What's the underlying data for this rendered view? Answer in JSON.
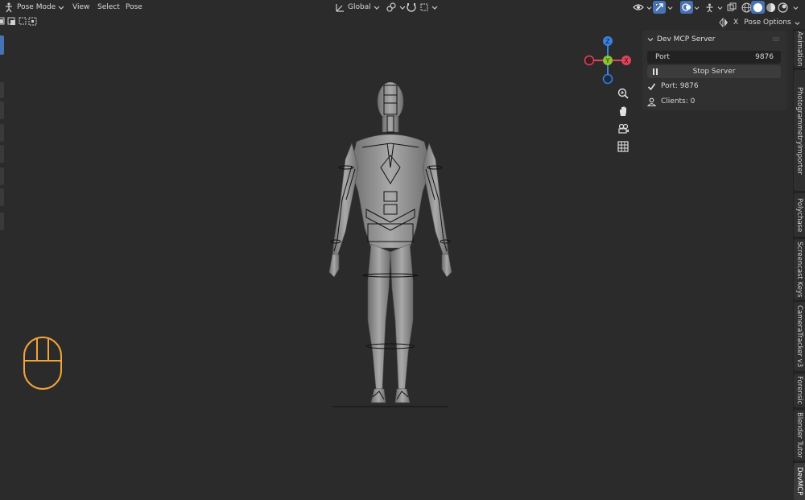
{
  "header": {
    "mode_label": "Pose Mode",
    "menus": [
      "View",
      "Select",
      "Pose"
    ],
    "transform_orientation": "Global",
    "pose_options_label": "Pose Options",
    "x_mirror_label": "X"
  },
  "panel": {
    "title": "Dev MCP Server",
    "port_label": "Port",
    "port_value": "9876",
    "stop_button_label": "Stop Server",
    "status_port": "Port: 9876",
    "status_clients": "Clients: 0"
  },
  "gizmo": {
    "z": "Z",
    "y": "Y",
    "x": "X"
  },
  "sidebar_tabs": [
    "Animation",
    "PhotogrammetryImporter",
    "Polychase",
    "Screencast Keys",
    "CameraTracker v3",
    "Forensic",
    "Blender Tutor",
    "DevMCP"
  ],
  "active_tab": "DevMCP",
  "colors": {
    "background": "#2b2b2b",
    "panel": "#303030",
    "accent_blue": "#4772b3",
    "axis_x": "#e0445a",
    "axis_y": "#8bc42f",
    "axis_z": "#3b82e0",
    "mouse_icon": "#f2a33a"
  },
  "icons": [
    "pose-mode-icon",
    "transform-orientation-icon",
    "pivot-icon",
    "snap-icon",
    "visibility-icon",
    "gizmo-toggle-icon",
    "overlay-icon",
    "xray-icon",
    "wireframe-shading-icon",
    "solid-shading-icon",
    "material-shading-icon",
    "rendered-shading-icon",
    "zoom-icon",
    "hand-pan-icon",
    "camera-icon",
    "grid-icon",
    "mouse-icon",
    "mirror-icon"
  ]
}
